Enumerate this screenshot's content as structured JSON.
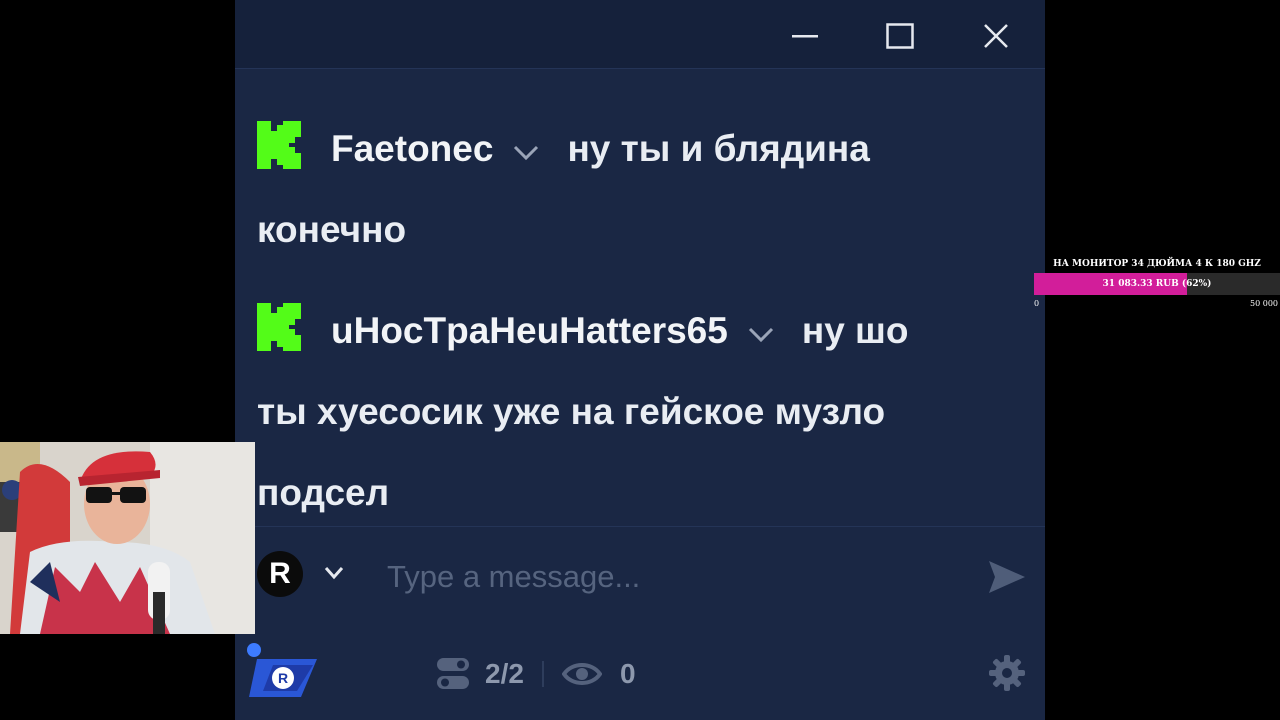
{
  "window": {
    "controls": [
      "minimize",
      "maximize",
      "close"
    ]
  },
  "messages": [
    {
      "platform": "kick",
      "username": "Faetonec",
      "text_first": "ну ты и блядина",
      "text_rest": "конечно"
    },
    {
      "platform": "kick",
      "username": "uHocTpaHeuHatters65",
      "text_first": "ну шо",
      "text_rest_1": "ты хуесосик уже на гейское музло",
      "text_rest_2": "подсел"
    }
  ],
  "composer": {
    "avatar_letter": "R",
    "placeholder": "Type a message..."
  },
  "footer": {
    "connections": "2/2",
    "viewers": "0",
    "logo_letter": "R"
  },
  "goal": {
    "title": "НА МОНИТОР 34 ДЮЙМА 4 К 180 GHZ",
    "label": "31 083.33 RUB (62%)",
    "progress_fraction": 0.62,
    "min": "0",
    "max": "50 000"
  },
  "colors": {
    "chat_bg": "#1a2744",
    "titlebar_bg": "#15213b",
    "kick_green": "#53fc18",
    "goal_fill": "#d21e9a"
  }
}
